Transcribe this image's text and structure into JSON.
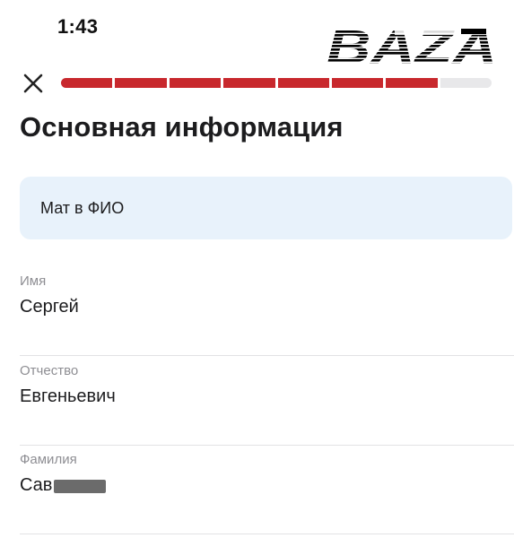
{
  "status_bar": {
    "time": "1:43"
  },
  "watermark": {
    "text": "BAZA"
  },
  "progress": {
    "total_steps": 8,
    "completed_steps": 7
  },
  "page": {
    "title": "Основная информация"
  },
  "notice": {
    "text": "Мат в ФИО"
  },
  "form": {
    "fields": [
      {
        "label": "Имя",
        "value": "Сергей"
      },
      {
        "label": "Отчество",
        "value": "Евгеньевич"
      },
      {
        "label": "Фамилия",
        "value": "Сав",
        "redacted_suffix": true
      }
    ]
  },
  "colors": {
    "progress_fill": "#c8282d",
    "progress_track": "#e8e8ea",
    "notice_bg": "#e8f2fb"
  },
  "icons": {
    "close": "close-icon"
  }
}
